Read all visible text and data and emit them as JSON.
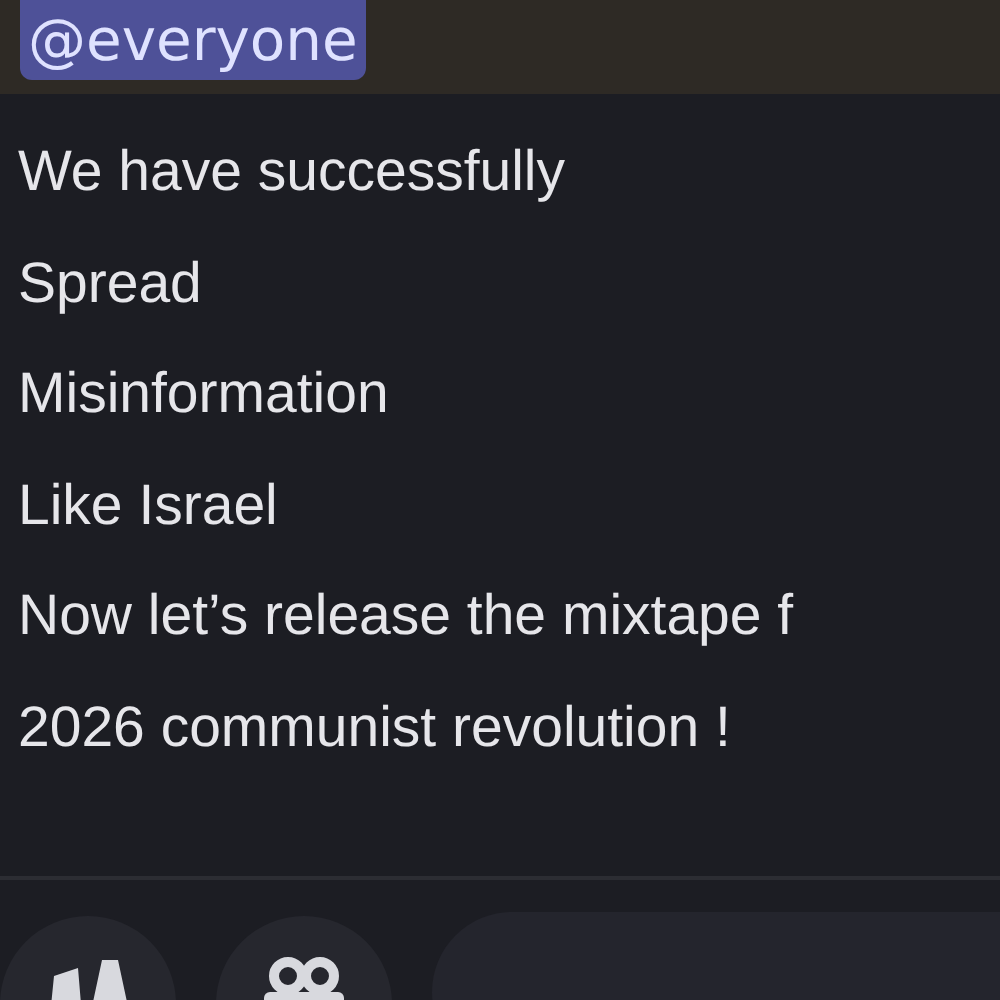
{
  "message": {
    "mention": "@everyone",
    "lines": [
      "We have successfully",
      "Spread",
      "Misinformation",
      "Like Israel",
      "Now let’s release the mixtape f",
      "2026 communist revolution !"
    ]
  },
  "composer": {
    "buttons": [
      {
        "kind": "apps"
      },
      {
        "kind": "gift"
      }
    ]
  }
}
